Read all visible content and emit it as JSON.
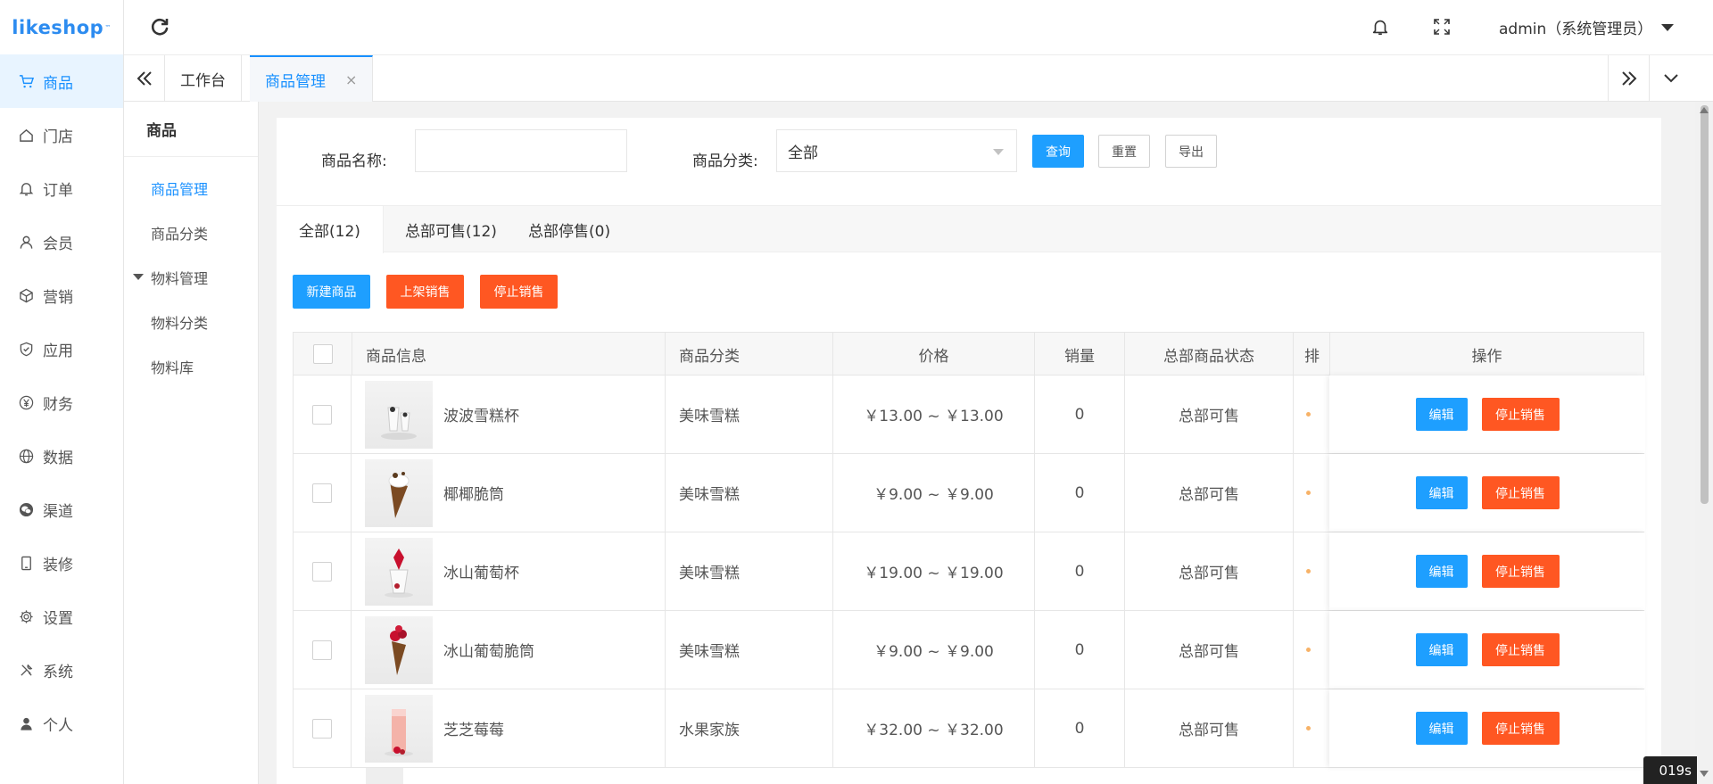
{
  "brand": {
    "logo_text": "likeshop",
    "logo_tm": "™"
  },
  "sidebar": {
    "items": [
      {
        "label": "商品",
        "icon": "cart-icon",
        "active": true
      },
      {
        "label": "门店",
        "icon": "home-icon"
      },
      {
        "label": "订单",
        "icon": "bell-icon"
      },
      {
        "label": "会员",
        "icon": "user-icon"
      },
      {
        "label": "营销",
        "icon": "cube-icon"
      },
      {
        "label": "应用",
        "icon": "shield-icon"
      },
      {
        "label": "财务",
        "icon": "yen-icon"
      },
      {
        "label": "数据",
        "icon": "globe-icon"
      },
      {
        "label": "渠道",
        "icon": "wechat-icon"
      },
      {
        "label": "装修",
        "icon": "tablet-icon"
      },
      {
        "label": "设置",
        "icon": "gear-icon"
      },
      {
        "label": "系统",
        "icon": "tools-icon"
      },
      {
        "label": "个人",
        "icon": "person-icon"
      }
    ]
  },
  "header": {
    "user": "admin（系统管理员）"
  },
  "tabs": [
    {
      "label": "工作台"
    },
    {
      "label": "商品管理",
      "close": "×",
      "active": true
    }
  ],
  "subnav": {
    "title": "商品",
    "items": [
      {
        "label": "商品管理",
        "active": true
      },
      {
        "label": "商品分类"
      },
      {
        "label": "物料管理",
        "group": true
      },
      {
        "label": "物料分类"
      },
      {
        "label": "物料库"
      }
    ]
  },
  "filter": {
    "name_label": "商品名称:",
    "name_value": "",
    "category_label": "商品分类:",
    "category_value": "全部",
    "query_btn": "查询",
    "reset_btn": "重置",
    "export_btn": "导出"
  },
  "status_tabs": [
    {
      "label": "全部(12)",
      "active": true
    },
    {
      "label": "总部可售(12)"
    },
    {
      "label": "总部停售(0)"
    }
  ],
  "actions": {
    "new": "新建商品",
    "on_sale": "上架销售",
    "stop_sale": "停止销售"
  },
  "table": {
    "headers": {
      "info": "商品信息",
      "category": "商品分类",
      "price": "价格",
      "sales": "销量",
      "status": "总部商品状态",
      "sort": "排",
      "ops": "操作"
    },
    "rows": [
      {
        "name": "波波雪糕杯",
        "category": "美味雪糕",
        "price": "￥13.00 ~ ￥13.00",
        "sales": "0",
        "status": "总部可售",
        "edit": "编辑",
        "stop": "停止销售"
      },
      {
        "name": "椰椰脆筒",
        "category": "美味雪糕",
        "price": "￥9.00 ~ ￥9.00",
        "sales": "0",
        "status": "总部可售",
        "edit": "编辑",
        "stop": "停止销售"
      },
      {
        "name": "冰山葡萄杯",
        "category": "美味雪糕",
        "price": "￥19.00 ~ ￥19.00",
        "sales": "0",
        "status": "总部可售",
        "edit": "编辑",
        "stop": "停止销售"
      },
      {
        "name": "冰山葡萄脆筒",
        "category": "美味雪糕",
        "price": "￥9.00 ~ ￥9.00",
        "sales": "0",
        "status": "总部可售",
        "edit": "编辑",
        "stop": "停止销售"
      },
      {
        "name": "芝芝莓莓",
        "category": "水果家族",
        "price": "￥32.00 ~ ￥32.00",
        "sales": "0",
        "status": "总部可售",
        "edit": "编辑",
        "stop": "停止销售"
      }
    ]
  },
  "overlay_badge": "019s",
  "colors": {
    "accent": "#1890ff",
    "primary_button": "#1e9fff",
    "danger_button": "#ff5722"
  }
}
